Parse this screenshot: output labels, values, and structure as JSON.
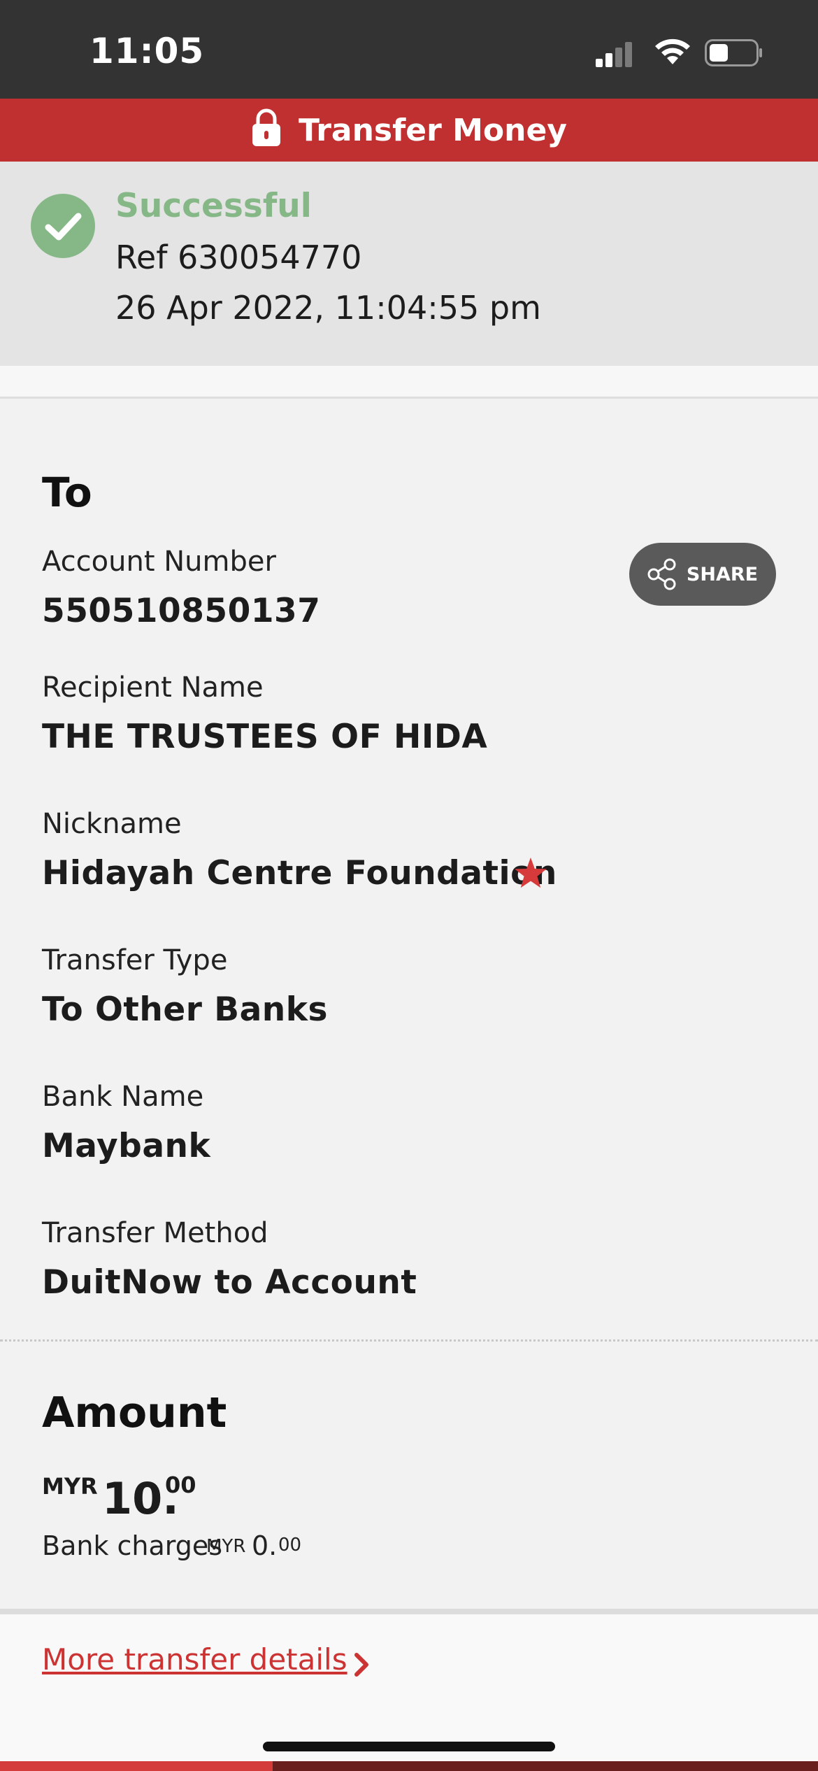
{
  "status_bar": {
    "time": "11:05"
  },
  "header": {
    "title": "Transfer Money",
    "color": "#c03030"
  },
  "result": {
    "status": "Successful",
    "status_color": "#86b887",
    "reference": "Ref 630054770",
    "datetime": "26 Apr 2022, 11:04:55 pm"
  },
  "recipient": {
    "heading": "To",
    "share_label": "SHARE",
    "fields": [
      {
        "label": "Account Number",
        "value": "550510850137"
      },
      {
        "label": "Recipient Name",
        "value": "THE TRUSTEES OF HIDA"
      },
      {
        "label": "Nickname",
        "value": "Hidayah Centre Foundation"
      },
      {
        "label": "Transfer Type",
        "value": "To Other Banks"
      },
      {
        "label": "Bank Name",
        "value": "Maybank"
      },
      {
        "label": "Transfer Method",
        "value": "DuitNow to Account"
      }
    ]
  },
  "amount": {
    "heading": "Amount",
    "currency": "MYR",
    "whole": "10.",
    "decimal": "00",
    "charges_label": "Bank charges",
    "charges_currency": "MYR",
    "charges_whole": "0.",
    "charges_decimal": "00"
  },
  "footer": {
    "more_details_label": "More transfer details",
    "accent": "#cc3333"
  }
}
